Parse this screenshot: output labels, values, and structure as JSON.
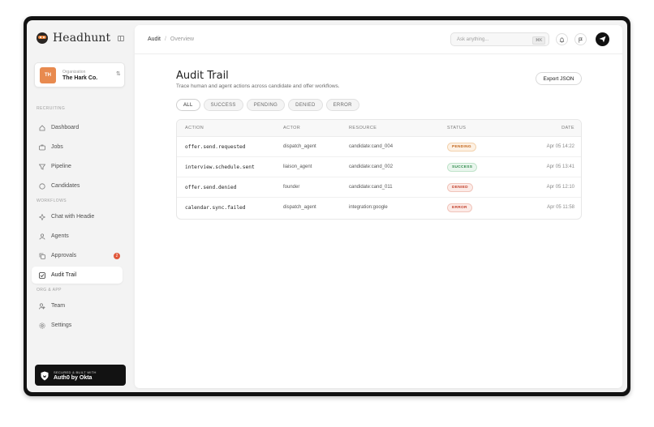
{
  "brand": {
    "name": "Headhunt"
  },
  "org": {
    "avatar_initials": "TH",
    "caption": "Organization",
    "name": "The Hark Co."
  },
  "sidebar": {
    "sections": {
      "recruiting": "RECRUITING",
      "workflows": "WORKFLOWS",
      "org_app": "ORG & APP"
    },
    "items": [
      {
        "label": "Dashboard",
        "icon": "home-icon"
      },
      {
        "label": "Jobs",
        "icon": "briefcase-icon"
      },
      {
        "label": "Pipeline",
        "icon": "filter-icon"
      },
      {
        "label": "Candidates",
        "icon": "chat-icon"
      },
      {
        "label": "Chat with Headie",
        "icon": "spark-icon"
      },
      {
        "label": "Agents",
        "icon": "agent-icon"
      },
      {
        "label": "Approvals",
        "icon": "copy-icon",
        "badge": "2"
      },
      {
        "label": "Audit Trail",
        "icon": "checklist-icon",
        "active": true
      },
      {
        "label": "Team",
        "icon": "user-icon"
      },
      {
        "label": "Settings",
        "icon": "gear-icon"
      }
    ]
  },
  "okta": {
    "small": "SECURED & BUILT WITH",
    "big": "Auth0 by Okta"
  },
  "topbar": {
    "breadcrumb": [
      "Audit",
      "Overview"
    ],
    "search_placeholder": "Ask anything...",
    "search_shortcut": "⌘K"
  },
  "page": {
    "title": "Audit Trail",
    "subtitle": "Trace human and agent actions across candidate and offer workflows.",
    "export_label": "Export JSON"
  },
  "filters": [
    "ALL",
    "SUCCESS",
    "PENDING",
    "DENIED",
    "ERROR"
  ],
  "table": {
    "columns": [
      "ACTION",
      "ACTOR",
      "RESOURCE",
      "STATUS",
      "DATE"
    ],
    "rows": [
      {
        "action": "offer.send.requested",
        "actor": "dispatch_agent",
        "resource": "candidate:cand_004",
        "status": "PENDING",
        "date": "Apr 05 14:22"
      },
      {
        "action": "interview.schedule.sent",
        "actor": "liaison_agent",
        "resource": "candidate:cand_002",
        "status": "SUCCESS",
        "date": "Apr 05 13:41"
      },
      {
        "action": "offer.send.denied",
        "actor": "founder",
        "resource": "candidate:cand_011",
        "status": "DENIED",
        "date": "Apr 05 12:10"
      },
      {
        "action": "calendar.sync.failed",
        "actor": "dispatch_agent",
        "resource": "integration:google",
        "status": "ERROR",
        "date": "Apr 05 11:58"
      }
    ]
  },
  "status_colors": {
    "PENDING": {
      "fg": "#c2661b",
      "bg": "#fdf1e4",
      "border": "#f3d2ad"
    },
    "SUCCESS": {
      "fg": "#2f8a4a",
      "bg": "#eaf6ee",
      "border": "#bfe3ca"
    },
    "DENIED": {
      "fg": "#c2412d",
      "bg": "#fcebe7",
      "border": "#f1c4ba"
    },
    "ERROR": {
      "fg": "#c2412d",
      "bg": "#fcebe7",
      "border": "#f1c4ba"
    }
  }
}
